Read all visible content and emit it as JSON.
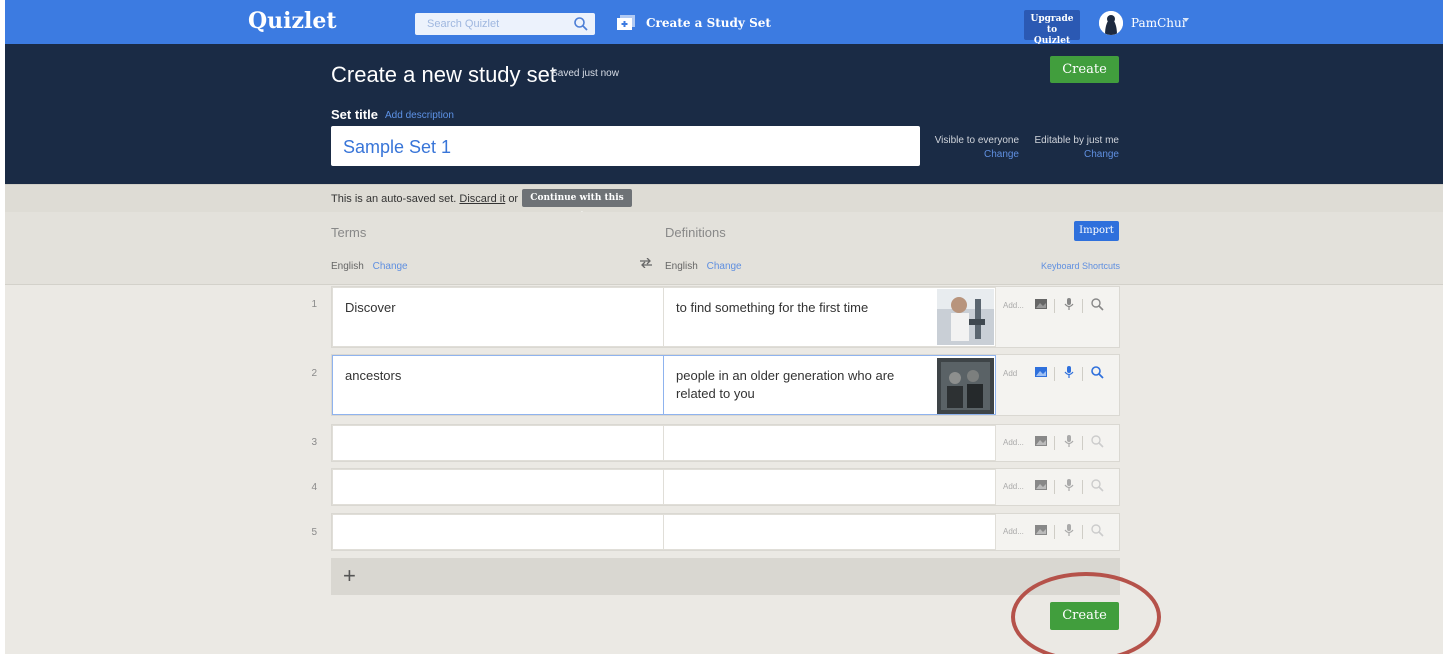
{
  "nav": {
    "logo": "Quizlet",
    "search_placeholder": "Search Quizlet",
    "create_set": "Create a Study Set",
    "upgrade_line1": "Upgrade to",
    "upgrade_line2": "Quizlet Plus",
    "username": "PamChui"
  },
  "header": {
    "title": "Create a new study set",
    "saved": "· Saved just now",
    "create_label": "Create",
    "set_title_label": "Set title",
    "add_description": "Add description",
    "set_title_value": "Sample Set 1",
    "visible_label": "Visible to everyone",
    "visible_change": "Change",
    "editable_label": "Editable by just me",
    "editable_change": "Change"
  },
  "autosave": {
    "prefix": "This is an auto-saved set.",
    "discard": "Discard it",
    "or": "or",
    "continue_label": "Continue with this set"
  },
  "columns": {
    "terms": "Terms",
    "definitions": "Definitions",
    "import_label": "Import",
    "term_language": "English",
    "def_language": "English",
    "change": "Change",
    "keyboard_shortcuts": "Keyboard Shortcuts"
  },
  "rows": [
    {
      "num": "1",
      "term": "Discover",
      "definition": "to find something for the first time",
      "add": "Add..."
    },
    {
      "num": "2",
      "term": "ancestors",
      "definition": "people in an older generation who are related to you",
      "add": "Add"
    },
    {
      "num": "3",
      "term": "",
      "definition": "",
      "add": "Add..."
    },
    {
      "num": "4",
      "term": "",
      "definition": "",
      "add": "Add..."
    },
    {
      "num": "5",
      "term": "",
      "definition": "",
      "add": "Add..."
    }
  ],
  "add_row_symbol": "+",
  "footer": {
    "create_label": "Create"
  },
  "colors": {
    "nav": "#3c7be1",
    "header": "#1a2b45",
    "green": "#419e3d",
    "annotation": "#b5524a"
  }
}
